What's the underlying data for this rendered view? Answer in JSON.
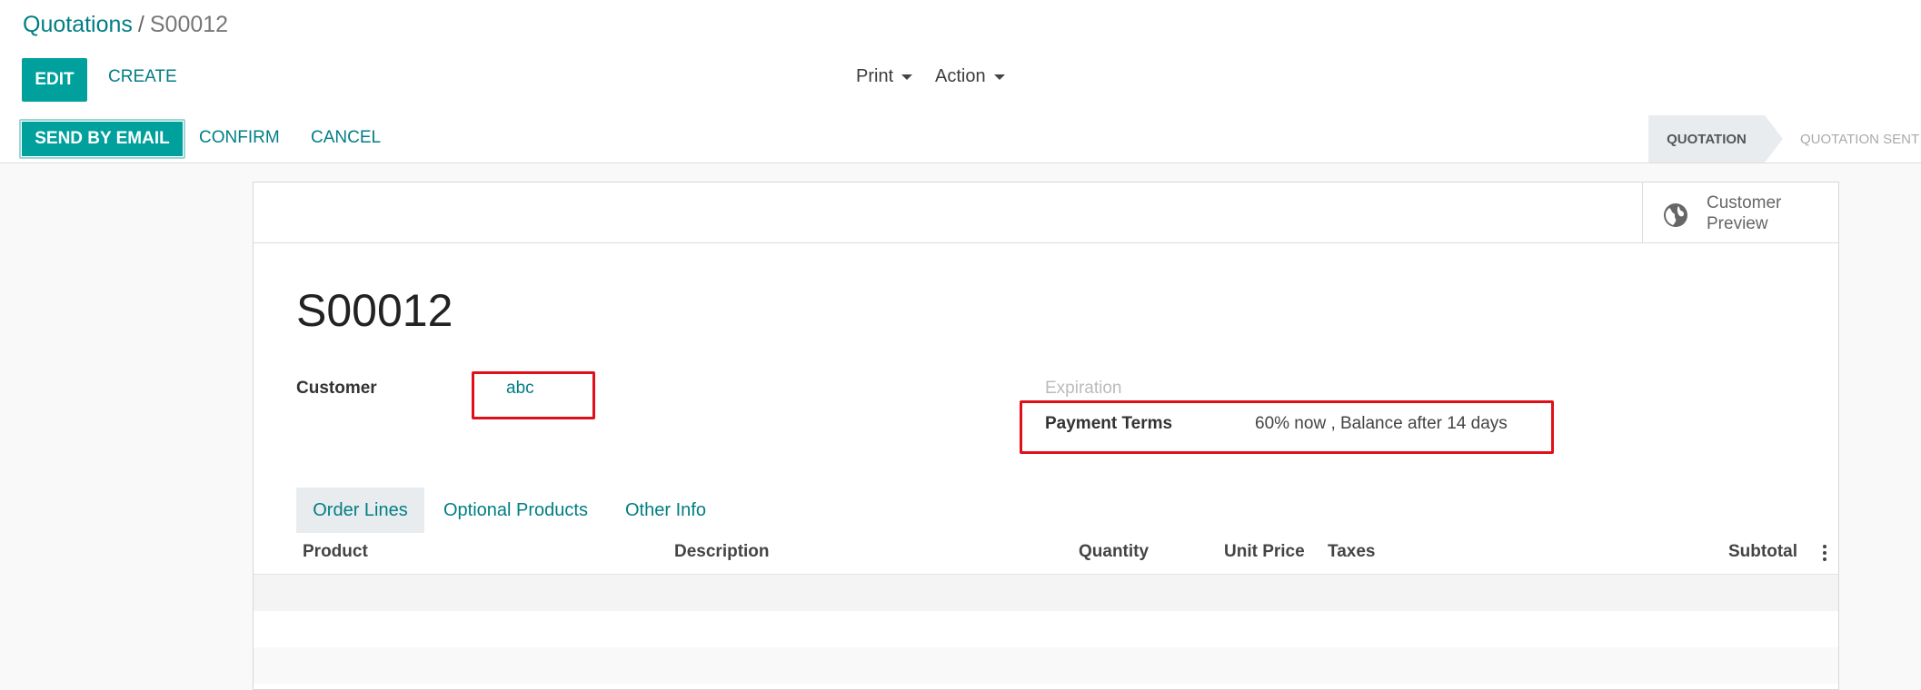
{
  "breadcrumb": {
    "parent": "Quotations",
    "separator": "/",
    "current": "S00012"
  },
  "toolbar": {
    "edit_label": "EDIT",
    "create_label": "CREATE",
    "print_label": "Print",
    "action_label": "Action"
  },
  "statusbar": {
    "send_label": "SEND BY EMAIL",
    "confirm_label": "CONFIRM",
    "cancel_label": "CANCEL",
    "stages": [
      {
        "label": "QUOTATION",
        "active": true
      },
      {
        "label": "QUOTATION SENT",
        "active": false
      }
    ]
  },
  "sheet": {
    "preview_label": "Customer Preview",
    "preview_icon": "globe-icon",
    "record_name": "S00012",
    "customer": {
      "label": "Customer",
      "value": "abc"
    },
    "expiration": {
      "label": "Expiration"
    },
    "payment_terms": {
      "label": "Payment Terms",
      "value": "60% now , Balance after 14 days"
    },
    "tabs": [
      {
        "label": "Order Lines",
        "active": true
      },
      {
        "label": "Optional Products",
        "active": false
      },
      {
        "label": "Other Info",
        "active": false
      }
    ],
    "columns": [
      "Product",
      "Description",
      "Quantity",
      "Unit Price",
      "Taxes",
      "Subtotal"
    ]
  },
  "colors": {
    "accent": "#00a09d",
    "link": "#017e84",
    "highlight": "#e0101a"
  }
}
